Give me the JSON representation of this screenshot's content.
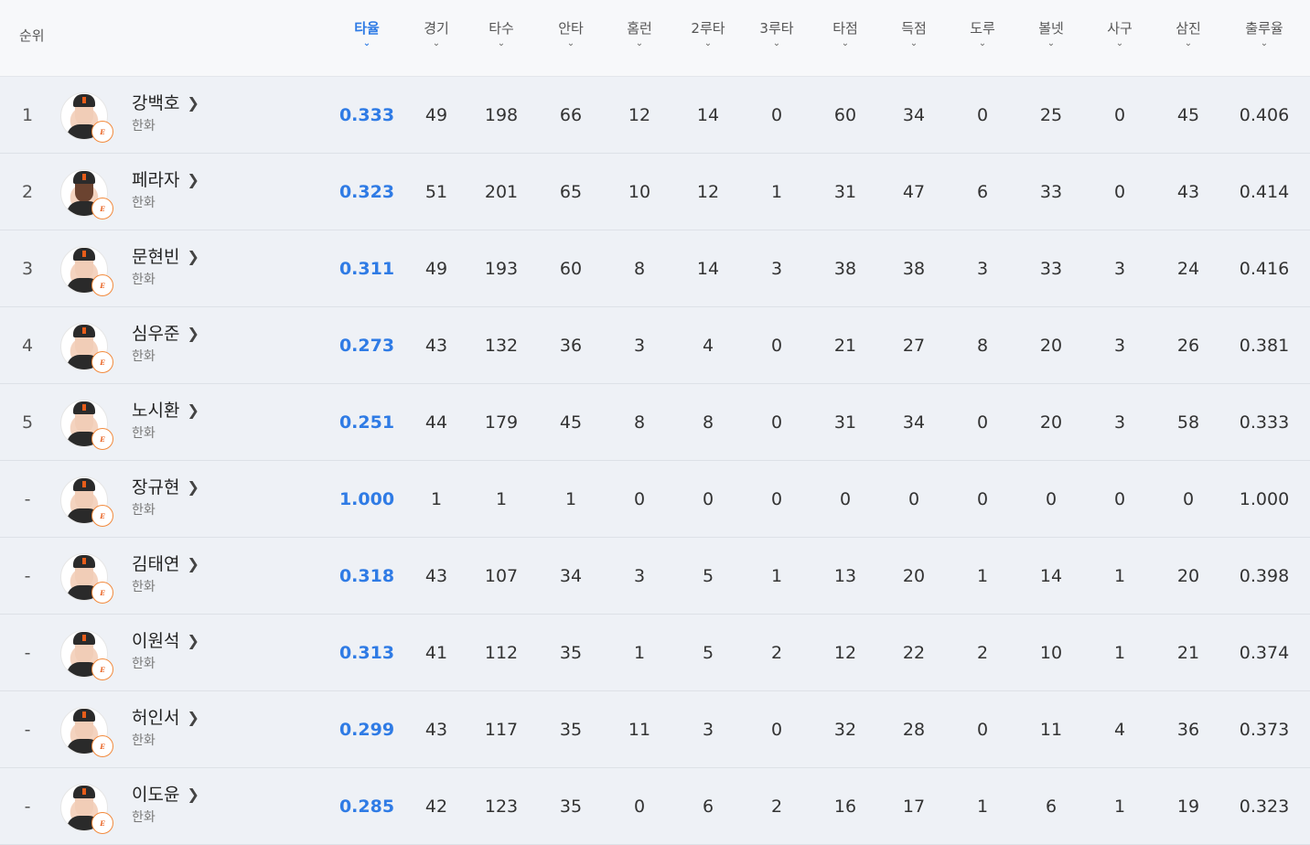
{
  "header": {
    "rank_label": "순위",
    "columns": [
      {
        "key": "avg",
        "label": "타율",
        "active": true
      },
      {
        "key": "games",
        "label": "경기"
      },
      {
        "key": "ab",
        "label": "타수"
      },
      {
        "key": "hits",
        "label": "안타"
      },
      {
        "key": "hr",
        "label": "홈런"
      },
      {
        "key": "doubles",
        "label": "2루타"
      },
      {
        "key": "triples",
        "label": "3루타"
      },
      {
        "key": "rbi",
        "label": "타점"
      },
      {
        "key": "runs",
        "label": "득점"
      },
      {
        "key": "sb",
        "label": "도루"
      },
      {
        "key": "bb",
        "label": "볼넷"
      },
      {
        "key": "hbp",
        "label": "사구"
      },
      {
        "key": "so",
        "label": "삼진"
      },
      {
        "key": "obp",
        "label": "출루율"
      }
    ]
  },
  "players": [
    {
      "rank": "1",
      "name": "강백호",
      "team": "한화",
      "stats": [
        "0.333",
        "49",
        "198",
        "66",
        "12",
        "14",
        "0",
        "60",
        "34",
        "0",
        "25",
        "0",
        "45",
        "0.406"
      ]
    },
    {
      "rank": "2",
      "name": "페라자",
      "team": "한화",
      "skin": "dark",
      "stats": [
        "0.323",
        "51",
        "201",
        "65",
        "10",
        "12",
        "1",
        "31",
        "47",
        "6",
        "33",
        "0",
        "43",
        "0.414"
      ]
    },
    {
      "rank": "3",
      "name": "문현빈",
      "team": "한화",
      "stats": [
        "0.311",
        "49",
        "193",
        "60",
        "8",
        "14",
        "3",
        "38",
        "38",
        "3",
        "33",
        "3",
        "24",
        "0.416"
      ]
    },
    {
      "rank": "4",
      "name": "심우준",
      "team": "한화",
      "stats": [
        "0.273",
        "43",
        "132",
        "36",
        "3",
        "4",
        "0",
        "21",
        "27",
        "8",
        "20",
        "3",
        "26",
        "0.381"
      ]
    },
    {
      "rank": "5",
      "name": "노시환",
      "team": "한화",
      "stats": [
        "0.251",
        "44",
        "179",
        "45",
        "8",
        "8",
        "0",
        "31",
        "34",
        "0",
        "20",
        "3",
        "58",
        "0.333"
      ]
    },
    {
      "rank": "-",
      "name": "장규현",
      "team": "한화",
      "stats": [
        "1.000",
        "1",
        "1",
        "1",
        "0",
        "0",
        "0",
        "0",
        "0",
        "0",
        "0",
        "0",
        "0",
        "1.000"
      ]
    },
    {
      "rank": "-",
      "name": "김태연",
      "team": "한화",
      "stats": [
        "0.318",
        "43",
        "107",
        "34",
        "3",
        "5",
        "1",
        "13",
        "20",
        "1",
        "14",
        "1",
        "20",
        "0.398"
      ]
    },
    {
      "rank": "-",
      "name": "이원석",
      "team": "한화",
      "stats": [
        "0.313",
        "41",
        "112",
        "35",
        "1",
        "5",
        "2",
        "12",
        "22",
        "2",
        "10",
        "1",
        "21",
        "0.374"
      ]
    },
    {
      "rank": "-",
      "name": "허인서",
      "team": "한화",
      "stats": [
        "0.299",
        "43",
        "117",
        "35",
        "11",
        "3",
        "0",
        "32",
        "28",
        "0",
        "11",
        "4",
        "36",
        "0.373"
      ]
    },
    {
      "rank": "-",
      "name": "이도윤",
      "team": "한화",
      "stats": [
        "0.285",
        "42",
        "123",
        "35",
        "0",
        "6",
        "2",
        "16",
        "17",
        "1",
        "6",
        "1",
        "19",
        "0.323"
      ]
    }
  ],
  "icons": {
    "sort": "chevron-down-icon",
    "player_link": "chevron-right-icon",
    "team_logo": "eagles-logo-icon"
  },
  "colors": {
    "accent": "#2f7be5",
    "row_bg": "#eef1f6",
    "team_badge": "#e85d1a"
  }
}
